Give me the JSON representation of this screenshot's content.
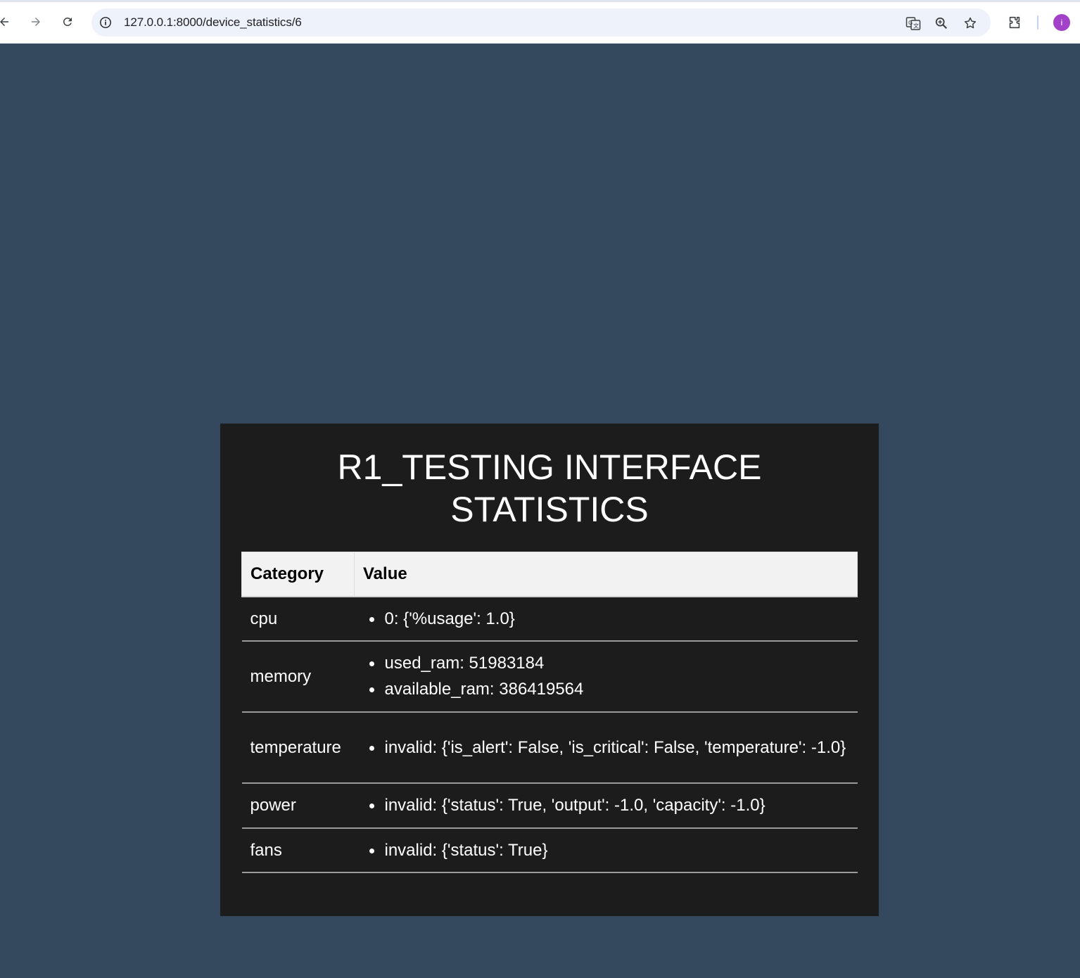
{
  "browser": {
    "url": "127.0.0.1:8000/device_statistics/6",
    "avatar_letter": "i",
    "avatar_color": "#a142c8",
    "icons": [
      "back-icon",
      "forward-icon",
      "reload-icon",
      "site-info-icon",
      "translate-icon",
      "zoom-icon",
      "bookmark-star-icon",
      "extensions-icon"
    ]
  },
  "page": {
    "background": "#34495e",
    "card_background": "#1c1c1c",
    "title_line1": "R1_TESTING INTERFACE",
    "title_line2": "STATISTICS",
    "table": {
      "headers": [
        "Category",
        "Value"
      ],
      "rows": [
        {
          "category": "cpu",
          "values": [
            "0: {'%usage': 1.0}"
          ]
        },
        {
          "category": "memory",
          "values": [
            "used_ram: 51983184",
            "available_ram: 386419564"
          ]
        },
        {
          "category": "temperature",
          "values": [
            "invalid: {'is_alert': False, 'is_critical': False, 'temperature': -1.0}"
          ]
        },
        {
          "category": "power",
          "values": [
            "invalid: {'status': True, 'output': -1.0, 'capacity': -1.0}"
          ]
        },
        {
          "category": "fans",
          "values": [
            "invalid: {'status': True}"
          ]
        }
      ]
    }
  }
}
